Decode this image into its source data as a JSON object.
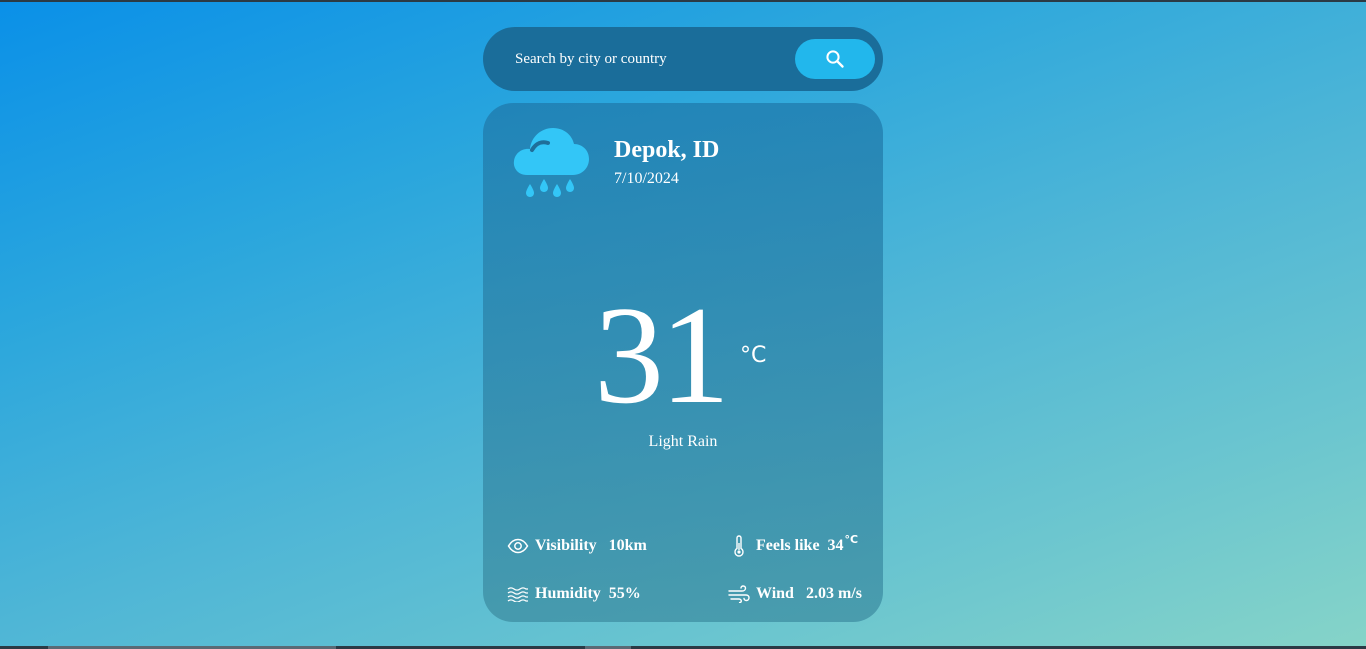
{
  "search": {
    "placeholder": "Search by city or country",
    "button_icon": "search-icon"
  },
  "weather": {
    "location": "Depok, ID",
    "date": "7/10/2024",
    "condition_icon": "rain-cloud-icon",
    "temperature": "31",
    "temperature_unit": "°C",
    "condition": "Light Rain"
  },
  "stats": {
    "visibility": {
      "icon": "eye-icon",
      "label": "Visibility",
      "value": "10km"
    },
    "feels_like": {
      "icon": "thermometer-icon",
      "label": "Feels like",
      "value": "34",
      "unit": "°C"
    },
    "humidity": {
      "icon": "waves-icon",
      "label": "Humidity",
      "value": "55%"
    },
    "wind": {
      "icon": "wind-icon",
      "label": "Wind",
      "value": "2.03 m/s"
    }
  },
  "colors": {
    "search_bar": "#1a6d9a",
    "search_button": "#22b7ec",
    "icon_cloud": "#33c6f7"
  }
}
